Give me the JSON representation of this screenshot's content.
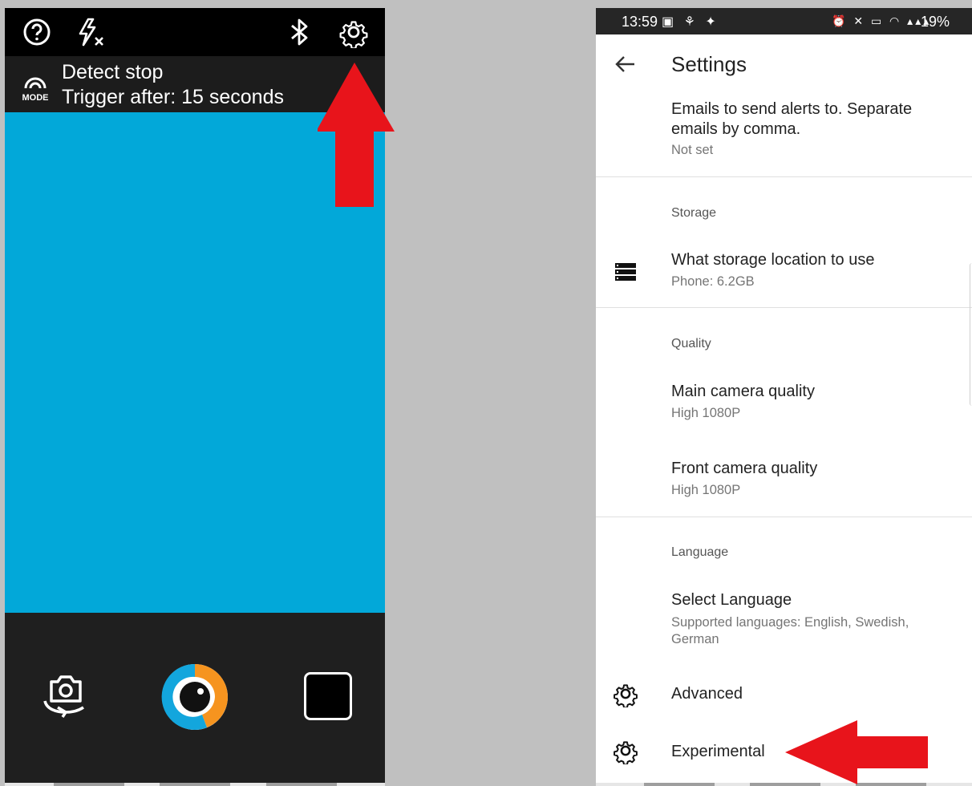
{
  "camera": {
    "mode_title": "Detect stop",
    "mode_trigger": "Trigger after: 15 seconds",
    "mode_label": "MODE",
    "icons": [
      "help-icon",
      "flash-off-icon",
      "bluetooth-icon",
      "gear-icon",
      "mode-icon",
      "switch-camera-icon",
      "shutter-button-icon",
      "stop-icon"
    ],
    "colors": {
      "viewfinder": "#02a8d9",
      "topbar": "#000000",
      "bottom": "#1f1f1f",
      "annotation_arrow": "#e8141b"
    }
  },
  "status_bar": {
    "time": "13:59",
    "battery": "19%"
  },
  "settings": {
    "title": "Settings",
    "email_pref": {
      "title": "Emails to send alerts to. Separate emails by comma.",
      "summary": "Not set"
    },
    "storage_category": "Storage",
    "storage_pref": {
      "title": "What storage location to use",
      "summary": "Phone: 6.2GB"
    },
    "quality_category": "Quality",
    "main_camera": {
      "title": "Main camera quality",
      "summary": "High 1080P"
    },
    "front_camera": {
      "title": "Front camera quality",
      "summary": "High 1080P"
    },
    "language_category": "Language",
    "language_pref": {
      "title": "Select Language",
      "summary": "Supported languages: English, Swedish, German"
    },
    "advanced": "Advanced",
    "experimental": "Experimental"
  }
}
